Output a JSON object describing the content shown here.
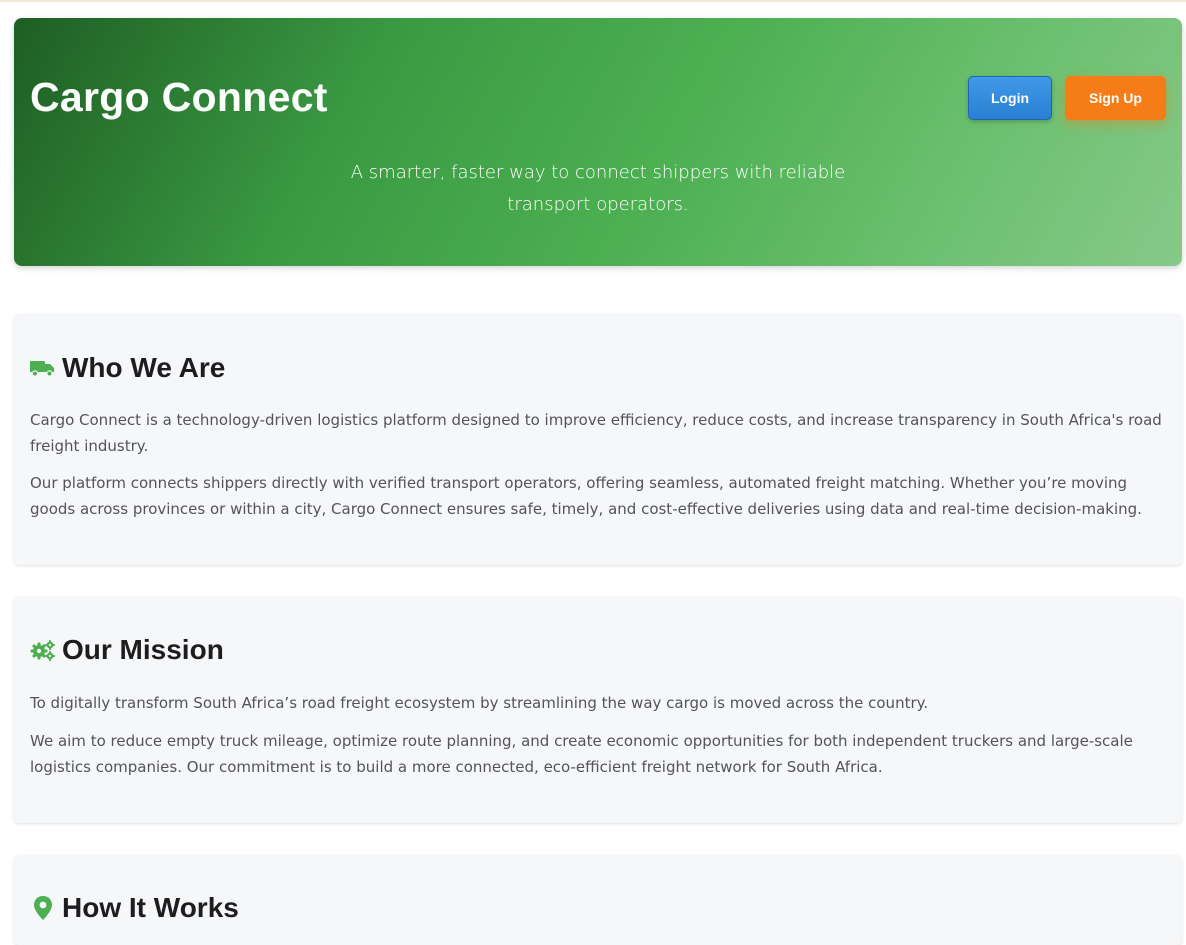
{
  "header": {
    "title": "Cargo Connect",
    "tagline": "A smarter, faster way to connect shippers with reliable transport operators.",
    "login_label": "Login",
    "signup_label": "Sign Up"
  },
  "about": {
    "heading": "Who We Are",
    "icon": "truck-icon",
    "paragraphs": [
      "Cargo Connect is a technology-driven logistics platform designed to improve efficiency, reduce costs, and increase transparency in South Africa's road freight industry.",
      "Our platform connects shippers directly with verified transport operators, offering seamless, automated freight matching. Whether you’re moving goods across provinces or within a city, Cargo Connect ensures safe, timely, and cost-effective deliveries using data and real-time decision-making."
    ]
  },
  "mission": {
    "heading": "Our Mission",
    "icon": "gears-icon",
    "paragraphs": [
      "To digitally transform South Africa’s road freight ecosystem by streamlining the way cargo is moved across the country.",
      "We aim to reduce empty truck mileage, optimize route planning, and create economic opportunities for both independent truckers and large-scale logistics companies. Our commitment is to build a more connected, eco-efficient freight network for South Africa."
    ]
  },
  "how": {
    "heading": "How It Works",
    "icon": "map-pin-icon"
  },
  "colors": {
    "accent_green": "#4caf50",
    "login_blue": "#2a7fd3",
    "signup_orange": "#f57c17"
  }
}
